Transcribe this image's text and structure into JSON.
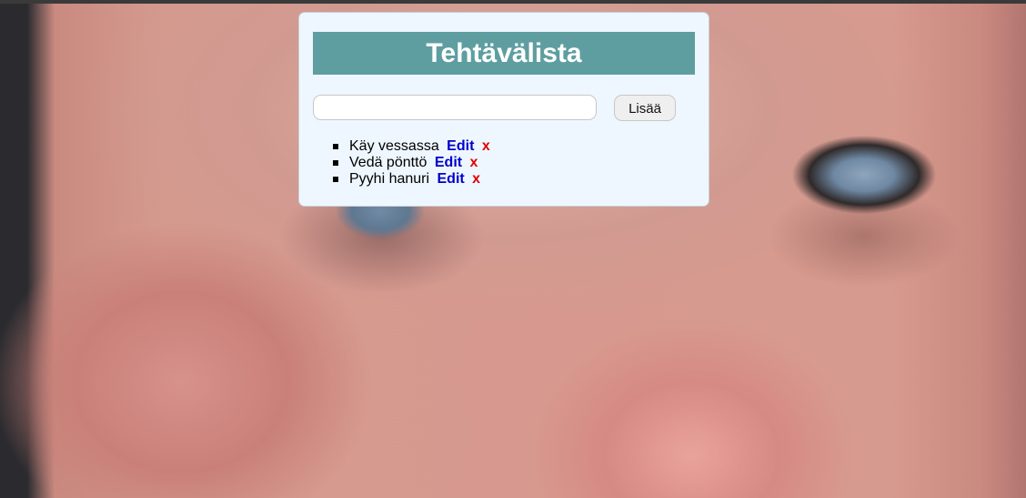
{
  "app": {
    "title": "Tehtävälista"
  },
  "form": {
    "input_value": "",
    "add_label": "Lisää"
  },
  "tasks": [
    {
      "text": "Käy vessassa",
      "edit_label": "Edit",
      "delete_label": "x"
    },
    {
      "text": "Vedä pönttö",
      "edit_label": "Edit",
      "delete_label": "x"
    },
    {
      "text": "Pyyhi hanuri",
      "edit_label": "Edit",
      "delete_label": "x"
    }
  ],
  "colors": {
    "title_bg": "#5f9ea0",
    "card_bg": "#eef7ff",
    "edit_link": "#0000cc",
    "delete_link": "#e00000"
  }
}
